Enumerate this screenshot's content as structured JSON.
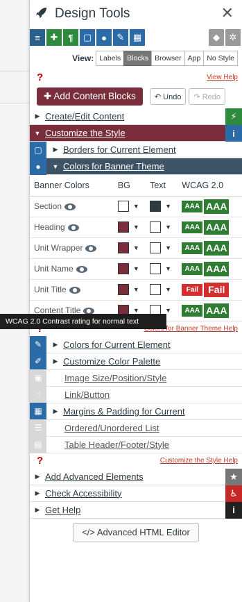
{
  "app": {
    "title": "Design Tools",
    "logo_icon": "rocket-icon",
    "close_glyph": "✕"
  },
  "iconbar": {
    "items": [
      {
        "name": "layout-icon",
        "glyph": "≡",
        "color": "#2b5f8c"
      },
      {
        "name": "puzzle-icon",
        "glyph": "✚",
        "color": "#2e8b3d"
      },
      {
        "name": "paragraph-icon",
        "glyph": "¶",
        "color": "#2e8b3d"
      },
      {
        "name": "square-icon",
        "glyph": "▢",
        "color": "#2b6ca8"
      },
      {
        "name": "droplet-icon",
        "glyph": "●",
        "color": "#2b6ca8"
      },
      {
        "name": "brush-icon",
        "glyph": "✎",
        "color": "#2b6ca8"
      },
      {
        "name": "grid-icon",
        "glyph": "▦",
        "color": "#2b6ca8"
      },
      {
        "name": "tag-icon",
        "glyph": "◆",
        "color": "#9a9a9a"
      },
      {
        "name": "gears-icon",
        "glyph": "✲",
        "color": "#9a9a9a"
      }
    ]
  },
  "view": {
    "label": "View:",
    "options": [
      "Labels",
      "Blocks",
      "Browser",
      "App",
      "No Style"
    ],
    "active": "Blocks"
  },
  "top_help": {
    "mark": "?",
    "link": "View Help"
  },
  "actions": {
    "add_label": "✚ Add Content Blocks",
    "undo_label": "↶ Undo",
    "redo_label": "↷ Redo"
  },
  "sections": {
    "create_edit": "Create/Edit Content",
    "customize_style": "Customize the Style",
    "borders": "Borders for Current Element",
    "colors_banner": "Colors for Banner Theme",
    "colors_current": "Colors for Current Element",
    "palette": "Customize Color Palette",
    "image_size": "Image Size/Position/Style",
    "link_button": "Link/Button",
    "margins": "Margins & Padding for Current",
    "lists": "Ordered/Unordered List",
    "table_header": "Table Header/Footer/Style",
    "advanced": "Add Advanced Elements",
    "accessibility": "Check Accessibility",
    "help": "Get Help"
  },
  "colors_table": {
    "headers": [
      "Banner Colors",
      "BG",
      "Text",
      "WCAG 2.0"
    ],
    "rows": [
      {
        "label": "Section",
        "bg": "#ffffff",
        "text": "#2d3b45",
        "small": "AAA",
        "large": "AAA",
        "status_color": "#2e7d32"
      },
      {
        "label": "Heading",
        "bg": "#7a2e3c",
        "text": "#ffffff",
        "small": "AAA",
        "large": "AAA",
        "status_color": "#2e7d32"
      },
      {
        "label": "Unit Wrapper",
        "bg": "#7a2e3c",
        "text": "#ffffff",
        "small": "AAA",
        "large": "AAA",
        "status_color": "#2e7d32"
      },
      {
        "label": "Unit Name",
        "bg": "#7a2e3c",
        "text": "#ffffff",
        "small": "AAA",
        "large": "AAA",
        "status_color": "#2e7d32"
      },
      {
        "label": "Unit Title",
        "bg": "#7a2e3c",
        "text": "#ffffff",
        "small": "Fail",
        "large": "Fail",
        "status_color": "#d32f2f"
      },
      {
        "label": "Content Title",
        "bg": "#7a2e3c",
        "text": "#ffffff",
        "small": "AAA",
        "large": "AAA",
        "status_color": "#2e7d32"
      }
    ]
  },
  "tooltip": "WCAG 2.0 Contrast rating for normal text",
  "banner_help": {
    "mark": "?",
    "link": "Colors for Banner Theme Help"
  },
  "style_help": {
    "mark": "?",
    "link": "Customize the Style Help"
  },
  "footer": {
    "label": "</> Advanced HTML Editor"
  },
  "colors": {
    "maroon": "#7a2e3c",
    "slate": "#3d5366",
    "green": "#2e7d32",
    "red": "#d32f2f"
  }
}
